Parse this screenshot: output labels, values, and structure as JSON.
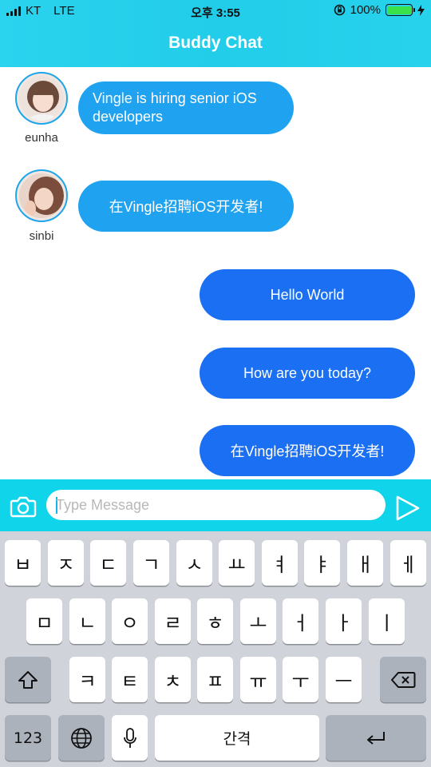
{
  "status_bar": {
    "carrier": "KT",
    "network": "LTE",
    "time": "오후 3:55",
    "battery_percent": "100%",
    "battery_level": 1.0,
    "battery_color": "#39e24a"
  },
  "header": {
    "title": "Buddy Chat"
  },
  "messages": {
    "incoming": [
      {
        "sender": "eunha",
        "text": "Vingle is hiring senior iOS developers"
      },
      {
        "sender": "sinbi",
        "text": "在Vingle招聘iOS开发者!"
      }
    ],
    "outgoing": [
      {
        "text": "Hello World"
      },
      {
        "text": "How are you today?"
      },
      {
        "text": "在Vingle招聘iOS开发者!"
      }
    ]
  },
  "input": {
    "placeholder": "Type Message",
    "value": ""
  },
  "keyboard": {
    "row1": [
      "ㅂ",
      "ㅈ",
      "ㄷ",
      "ㄱ",
      "ㅅ",
      "ㅛ",
      "ㅕ",
      "ㅑ",
      "ㅐ",
      "ㅔ"
    ],
    "row2": [
      "ㅁ",
      "ㄴ",
      "ㅇ",
      "ㄹ",
      "ㅎ",
      "ㅗ",
      "ㅓ",
      "ㅏ",
      "ㅣ"
    ],
    "row3": [
      "ㅋ",
      "ㅌ",
      "ㅊ",
      "ㅍ",
      "ㅠ",
      "ㅜ",
      "ㅡ"
    ],
    "numbers_label": "123",
    "space_label": "간격"
  },
  "colors": {
    "header": "#22cde9",
    "incoming_bubble": "#1fa2ef",
    "outgoing_bubble": "#1b6ff3",
    "input_bar": "#10d5ea"
  },
  "icons": {
    "camera": "camera-icon",
    "send": "send-icon",
    "shift": "shift-icon",
    "backspace": "backspace-icon",
    "globe": "globe-icon",
    "mic": "microphone-icon",
    "return": "return-icon"
  }
}
